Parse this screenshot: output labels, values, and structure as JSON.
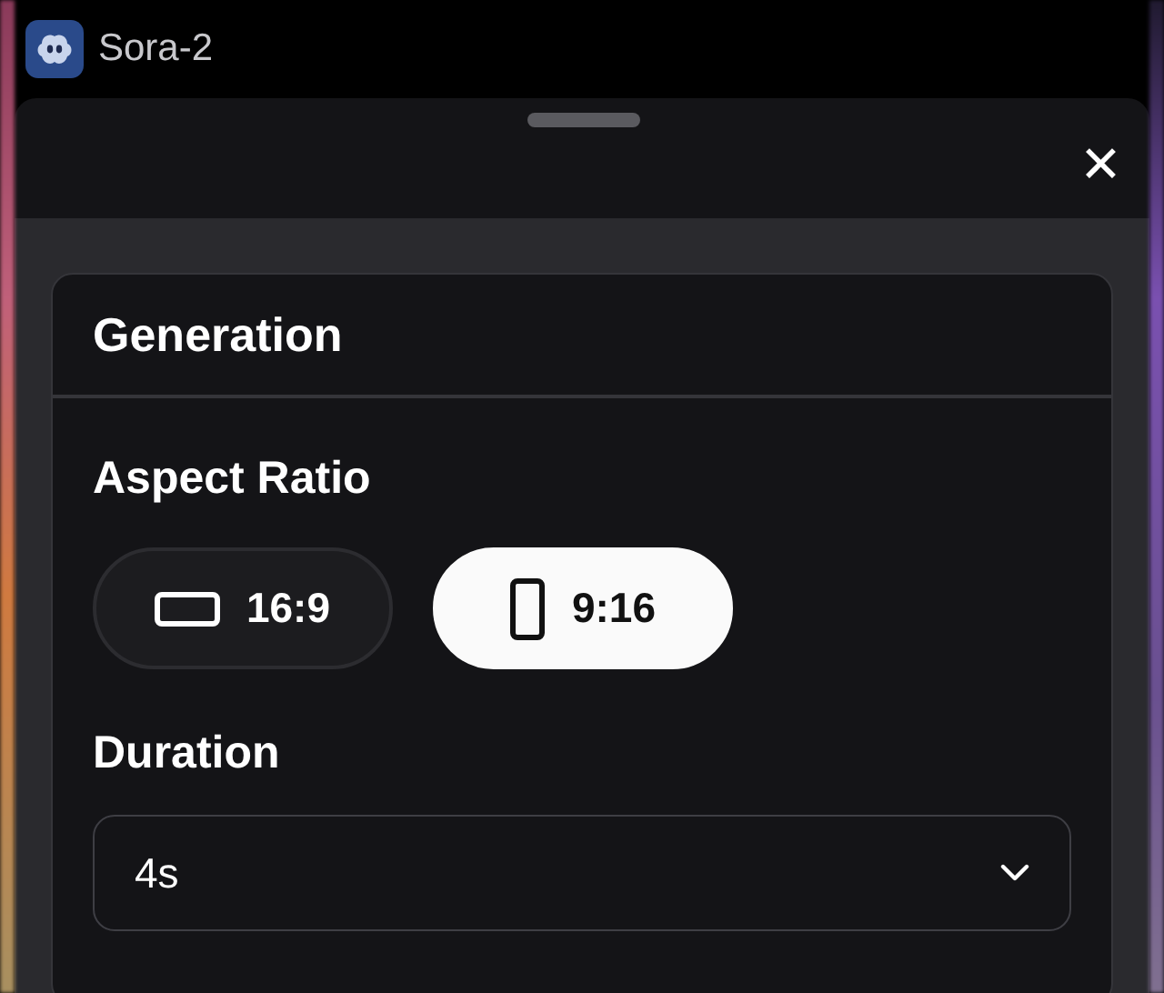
{
  "app": {
    "title": "Sora-2"
  },
  "sheet": {
    "close_label": "✕"
  },
  "card": {
    "title": "Generation",
    "aspect_ratio": {
      "label": "Aspect Ratio",
      "options": [
        {
          "label": "16:9",
          "kind": "landscape",
          "selected": false
        },
        {
          "label": "9:16",
          "kind": "portrait",
          "selected": true
        }
      ]
    },
    "duration": {
      "label": "Duration",
      "value": "4s"
    }
  }
}
